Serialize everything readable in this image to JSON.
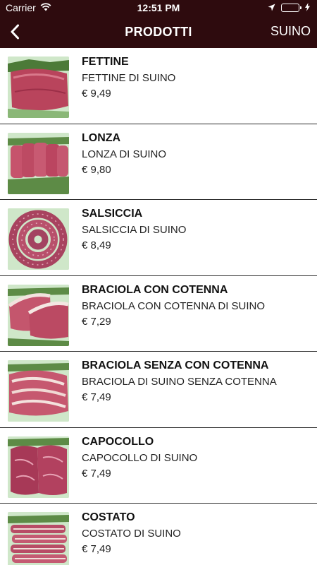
{
  "status_bar": {
    "carrier": "Carrier",
    "time": "12:51 PM",
    "battery_level": 1.0,
    "icons": [
      "wifi-icon",
      "location-arrow-icon",
      "battery-icon",
      "charging-bolt-icon"
    ]
  },
  "nav": {
    "title": "PRODOTTI",
    "right_label": "SUINO",
    "back_icon": "chevron-left-icon"
  },
  "colors": {
    "header_bg": "#2e0b0e",
    "header_text": "#ffffff",
    "battery_green": "#4cd964",
    "divider": "#2b2b2b"
  },
  "products": [
    {
      "name": "FETTINE",
      "description": "FETTINE DI SUINO",
      "price": "€ 9,49"
    },
    {
      "name": "LONZA",
      "description": "LONZA DI SUINO",
      "price": "€ 9,80"
    },
    {
      "name": "SALSICCIA",
      "description": "SALSICCIA DI SUINO",
      "price": "€ 8,49"
    },
    {
      "name": "BRACIOLA CON COTENNA",
      "description": "BRACIOLA CON COTENNA DI SUINO",
      "price": "€ 7,29"
    },
    {
      "name": "BRACIOLA SENZA CON COTENNA",
      "description": "BRACIOLA DI SUINO SENZA COTENNA",
      "price": "€ 7,49"
    },
    {
      "name": "CAPOCOLLO",
      "description": "CAPOCOLLO DI SUINO",
      "price": "€ 7,49"
    },
    {
      "name": "COSTATO",
      "description": "COSTATO DI SUINO",
      "price": "€ 7,49"
    }
  ]
}
